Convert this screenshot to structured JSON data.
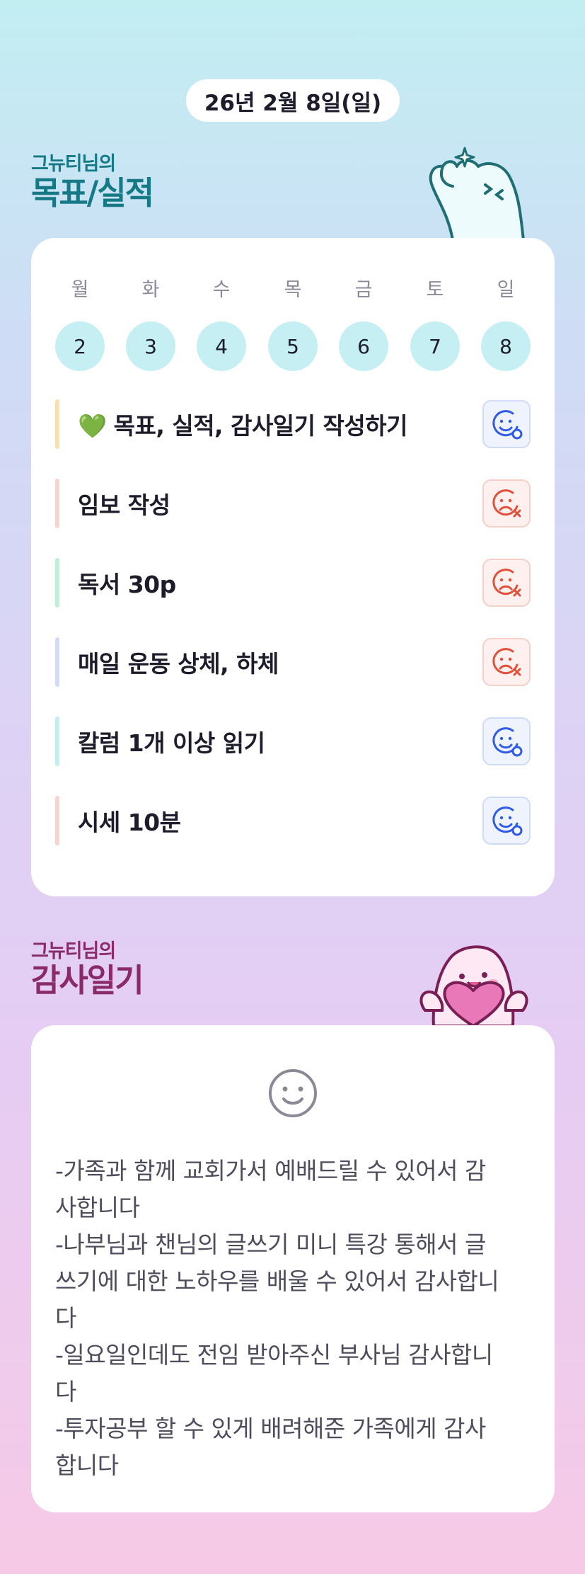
{
  "date": "26년 2월 8일(일)",
  "goals_section": {
    "subtitle": "그뉴티님의",
    "title": "목표/실적"
  },
  "week": [
    {
      "day": "월",
      "num": "2"
    },
    {
      "day": "화",
      "num": "3"
    },
    {
      "day": "수",
      "num": "4"
    },
    {
      "day": "목",
      "num": "5"
    },
    {
      "day": "금",
      "num": "6"
    },
    {
      "day": "토",
      "num": "7"
    },
    {
      "day": "일",
      "num": "8"
    }
  ],
  "goals": [
    {
      "heart": "💚",
      "text": "목표, 실적, 감사일기 작성하기",
      "status": "done",
      "bar_color": "#f9dfae"
    },
    {
      "heart": "",
      "text": "임보 작성",
      "status": "fail",
      "bar_color": "#f9d3cf"
    },
    {
      "heart": "",
      "text": "독서 30p",
      "status": "fail",
      "bar_color": "#bfeed9"
    },
    {
      "heart": "",
      "text": "매일 운동 상체, 하체",
      "status": "fail",
      "bar_color": "#cfdcf6"
    },
    {
      "heart": "",
      "text": "칼럼 1개 이상 읽기",
      "status": "done",
      "bar_color": "#c2eef2"
    },
    {
      "heart": "",
      "text": "시세 10분",
      "status": "done",
      "bar_color": "#f9d3cf"
    }
  ],
  "status_icons": {
    "done": "smile-check-icon",
    "fail": "frown-x-icon"
  },
  "colors": {
    "done": "#2f5be6",
    "fail": "#e0503a"
  },
  "gratitude_section": {
    "subtitle": "그뉴티님의",
    "title": "감사일기",
    "mood_icon": "smile-face-icon",
    "text": "-가족과 함께 교회가서 예배드릴 수 있어서 감\n사합니다\n-나부님과 챈님의 글쓰기 미니 특강 통해서 글\n쓰기에 대한 노하우를 배울 수 있어서 감사합니\n다\n-일요일인데도 전임 받아주신 부사님 감사합니\n다\n-투자공부 할 수 있게 배려해준 가족에게 감사\n합니다"
  }
}
